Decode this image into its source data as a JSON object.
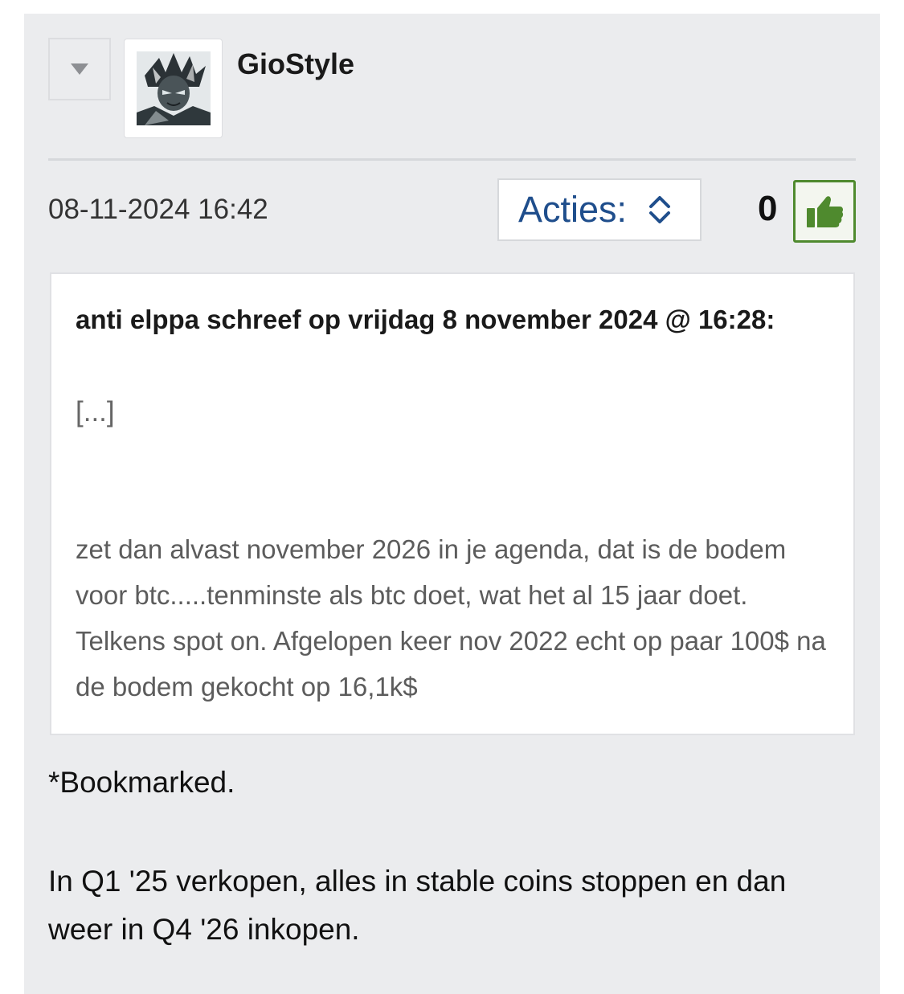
{
  "post": {
    "username": "GioStyle",
    "timestamp": "08-11-2024 16:42",
    "actions_label": "Acties:",
    "vote_count": "0",
    "icons": {
      "toggle": "caret-down-icon",
      "actions": "updown-chevron-icon",
      "like": "thumbs-up-icon"
    },
    "colors": {
      "link_blue": "#1f4e8c",
      "like_green": "#4f8a2e",
      "panel_bg": "#ebecee"
    }
  },
  "quote": {
    "header": "anti elppa schreef op vrijdag 8 november 2024 @ 16:28:",
    "ellipsis": "[...]",
    "body": "zet dan alvast november 2026 in je agenda, dat is de bodem voor btc.....tenminste als btc doet, wat het al 15 jaar doet. Telkens spot on. Afgelopen keer nov 2022 echt op paar 100$ na de bodem gekocht op 16,1k$"
  },
  "reply": {
    "line1": "*Bookmarked.",
    "line2": "In Q1 '25 verkopen, alles in stable coins stoppen en dan weer in Q4 '26 inkopen."
  }
}
